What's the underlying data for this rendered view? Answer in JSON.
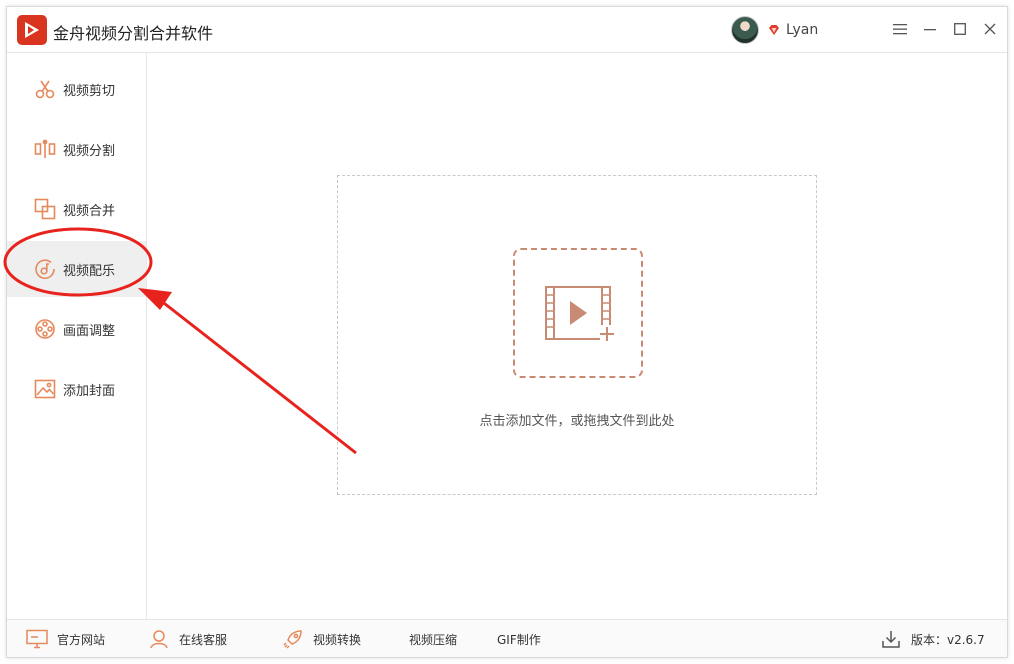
{
  "app": {
    "title": "金舟视频分割合并软件",
    "accent_color": "#e0462f",
    "icon_color": "#e58a5c"
  },
  "user": {
    "name": "Lyan",
    "avatar_icon": "avatar",
    "badge_icon": "vip-diamond-icon"
  },
  "window_controls": {
    "menu_icon": "menu-icon",
    "minimize_icon": "minimize-icon",
    "maximize_icon": "maximize-icon",
    "close_icon": "close-icon"
  },
  "sidebar": {
    "active_index": 3,
    "items": [
      {
        "label": "视频剪切",
        "icon": "scissors-icon"
      },
      {
        "label": "视频分割",
        "icon": "split-icon"
      },
      {
        "label": "视频合并",
        "icon": "merge-icon"
      },
      {
        "label": "视频配乐",
        "icon": "music-icon"
      },
      {
        "label": "画面调整",
        "icon": "film-reel-icon"
      },
      {
        "label": "添加封面",
        "icon": "image-icon"
      }
    ]
  },
  "main": {
    "drop_text": "点击添加文件，或拖拽文件到此处",
    "add_icon": "add-video-icon",
    "add_icon_color": "#c98a74"
  },
  "footer": {
    "items": [
      {
        "label": "官方网站",
        "icon": "monitor-icon"
      },
      {
        "label": "在线客服",
        "icon": "headset-icon"
      },
      {
        "label": "视频转换",
        "icon": "rocket-icon"
      },
      {
        "label": "视频压缩",
        "icon": ""
      },
      {
        "label": "GIF制作",
        "icon": ""
      }
    ],
    "version": "版本：v2.6.7",
    "version_icon": "download-icon"
  },
  "annotation": {
    "color": "#e8231d"
  }
}
